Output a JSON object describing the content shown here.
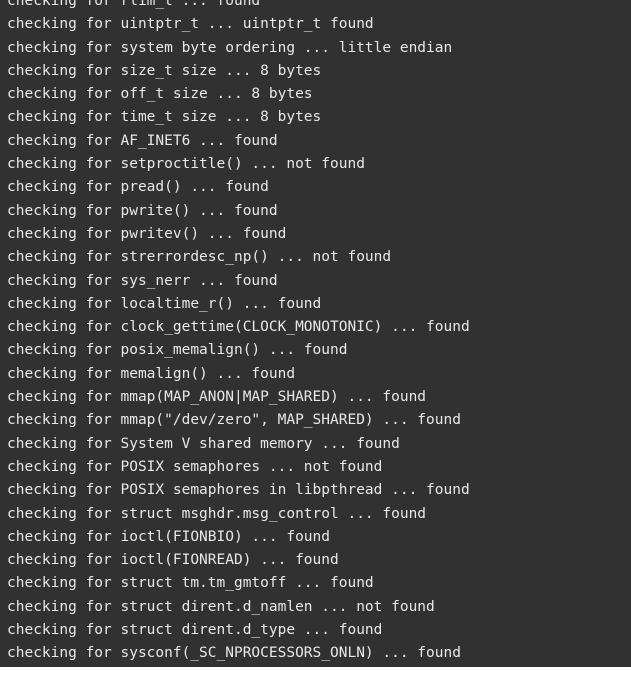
{
  "terminal": {
    "background_color": "#313131",
    "text_color": "#e8e8e8",
    "bottom_strip_color": "#ffffff",
    "lines": [
      "checking for rlim_t ... found",
      "checking for uintptr_t ... uintptr_t found",
      "checking for system byte ordering ... little endian",
      "checking for size_t size ... 8 bytes",
      "checking for off_t size ... 8 bytes",
      "checking for time_t size ... 8 bytes",
      "checking for AF_INET6 ... found",
      "checking for setproctitle() ... not found",
      "checking for pread() ... found",
      "checking for pwrite() ... found",
      "checking for pwritev() ... found",
      "checking for strerrordesc_np() ... not found",
      "checking for sys_nerr ... found",
      "checking for localtime_r() ... found",
      "checking for clock_gettime(CLOCK_MONOTONIC) ... found",
      "checking for posix_memalign() ... found",
      "checking for memalign() ... found",
      "checking for mmap(MAP_ANON|MAP_SHARED) ... found",
      "checking for mmap(\"/dev/zero\", MAP_SHARED) ... found",
      "checking for System V shared memory ... found",
      "checking for POSIX semaphores ... not found",
      "checking for POSIX semaphores in libpthread ... found",
      "checking for struct msghdr.msg_control ... found",
      "checking for ioctl(FIONBIO) ... found",
      "checking for ioctl(FIONREAD) ... found",
      "checking for struct tm.tm_gmtoff ... found",
      "checking for struct dirent.d_namlen ... not found",
      "checking for struct dirent.d_type ... found",
      "checking for sysconf(_SC_NPROCESSORS_ONLN) ... found"
    ]
  }
}
